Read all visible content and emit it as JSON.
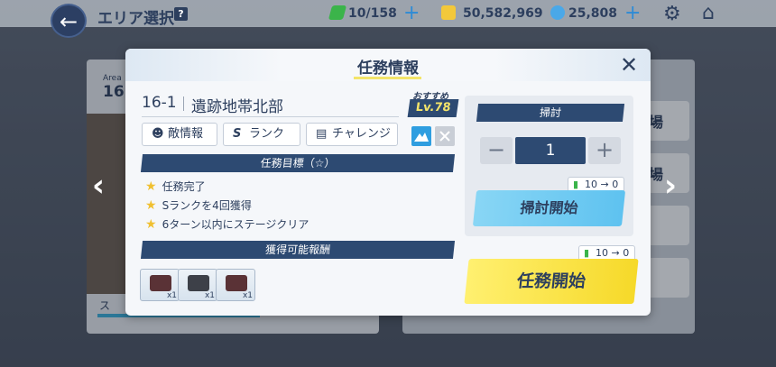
{
  "topbar": {
    "title": "エリア選択",
    "help_icon": "?",
    "back_icon": "←",
    "ap": "10/158",
    "credits": "50,582,969",
    "gems": "25,808",
    "plus": "+",
    "settings_icon": "⚙",
    "home_icon": "⌂",
    "colors": {
      "ap_icon": "#3bb44a",
      "credit_icon": "#f3c83a",
      "gem_icon": "#4aa8e8"
    }
  },
  "background": {
    "area_label": "Area",
    "area_number": "16",
    "star_label": "ス",
    "side_button_labels": [
      "場",
      "場"
    ],
    "nav_prev": "‹",
    "nav_next": "›"
  },
  "modal": {
    "title": "任務情報",
    "close_icon": "✕",
    "stage_code": "16-1",
    "stage_name": "遺跡地帯北部",
    "recommended_label": "おすすめ",
    "recommended_level": "Lv.78",
    "tabs": [
      {
        "icon": "☻",
        "label": "敵情報"
      },
      {
        "icon": "S",
        "label": "ランク"
      },
      {
        "icon": "▤",
        "label": "チャレンジ"
      }
    ],
    "goals_header": "任務目標（☆）",
    "goals": [
      "任務完了",
      "Sランクを4回獲得",
      "6ターン以内にステージクリア"
    ],
    "rewards_header": "獲得可能報酬",
    "rewards": [
      {
        "count": "x1"
      },
      {
        "count": "x1"
      },
      {
        "count": "x1"
      }
    ],
    "sweep": {
      "header": "掃討",
      "minus": "−",
      "quantity": "1",
      "plus": "+",
      "cost": "10 → 0",
      "button": "掃討開始"
    },
    "start": {
      "cost": "10 → 0",
      "button": "任務開始"
    }
  }
}
